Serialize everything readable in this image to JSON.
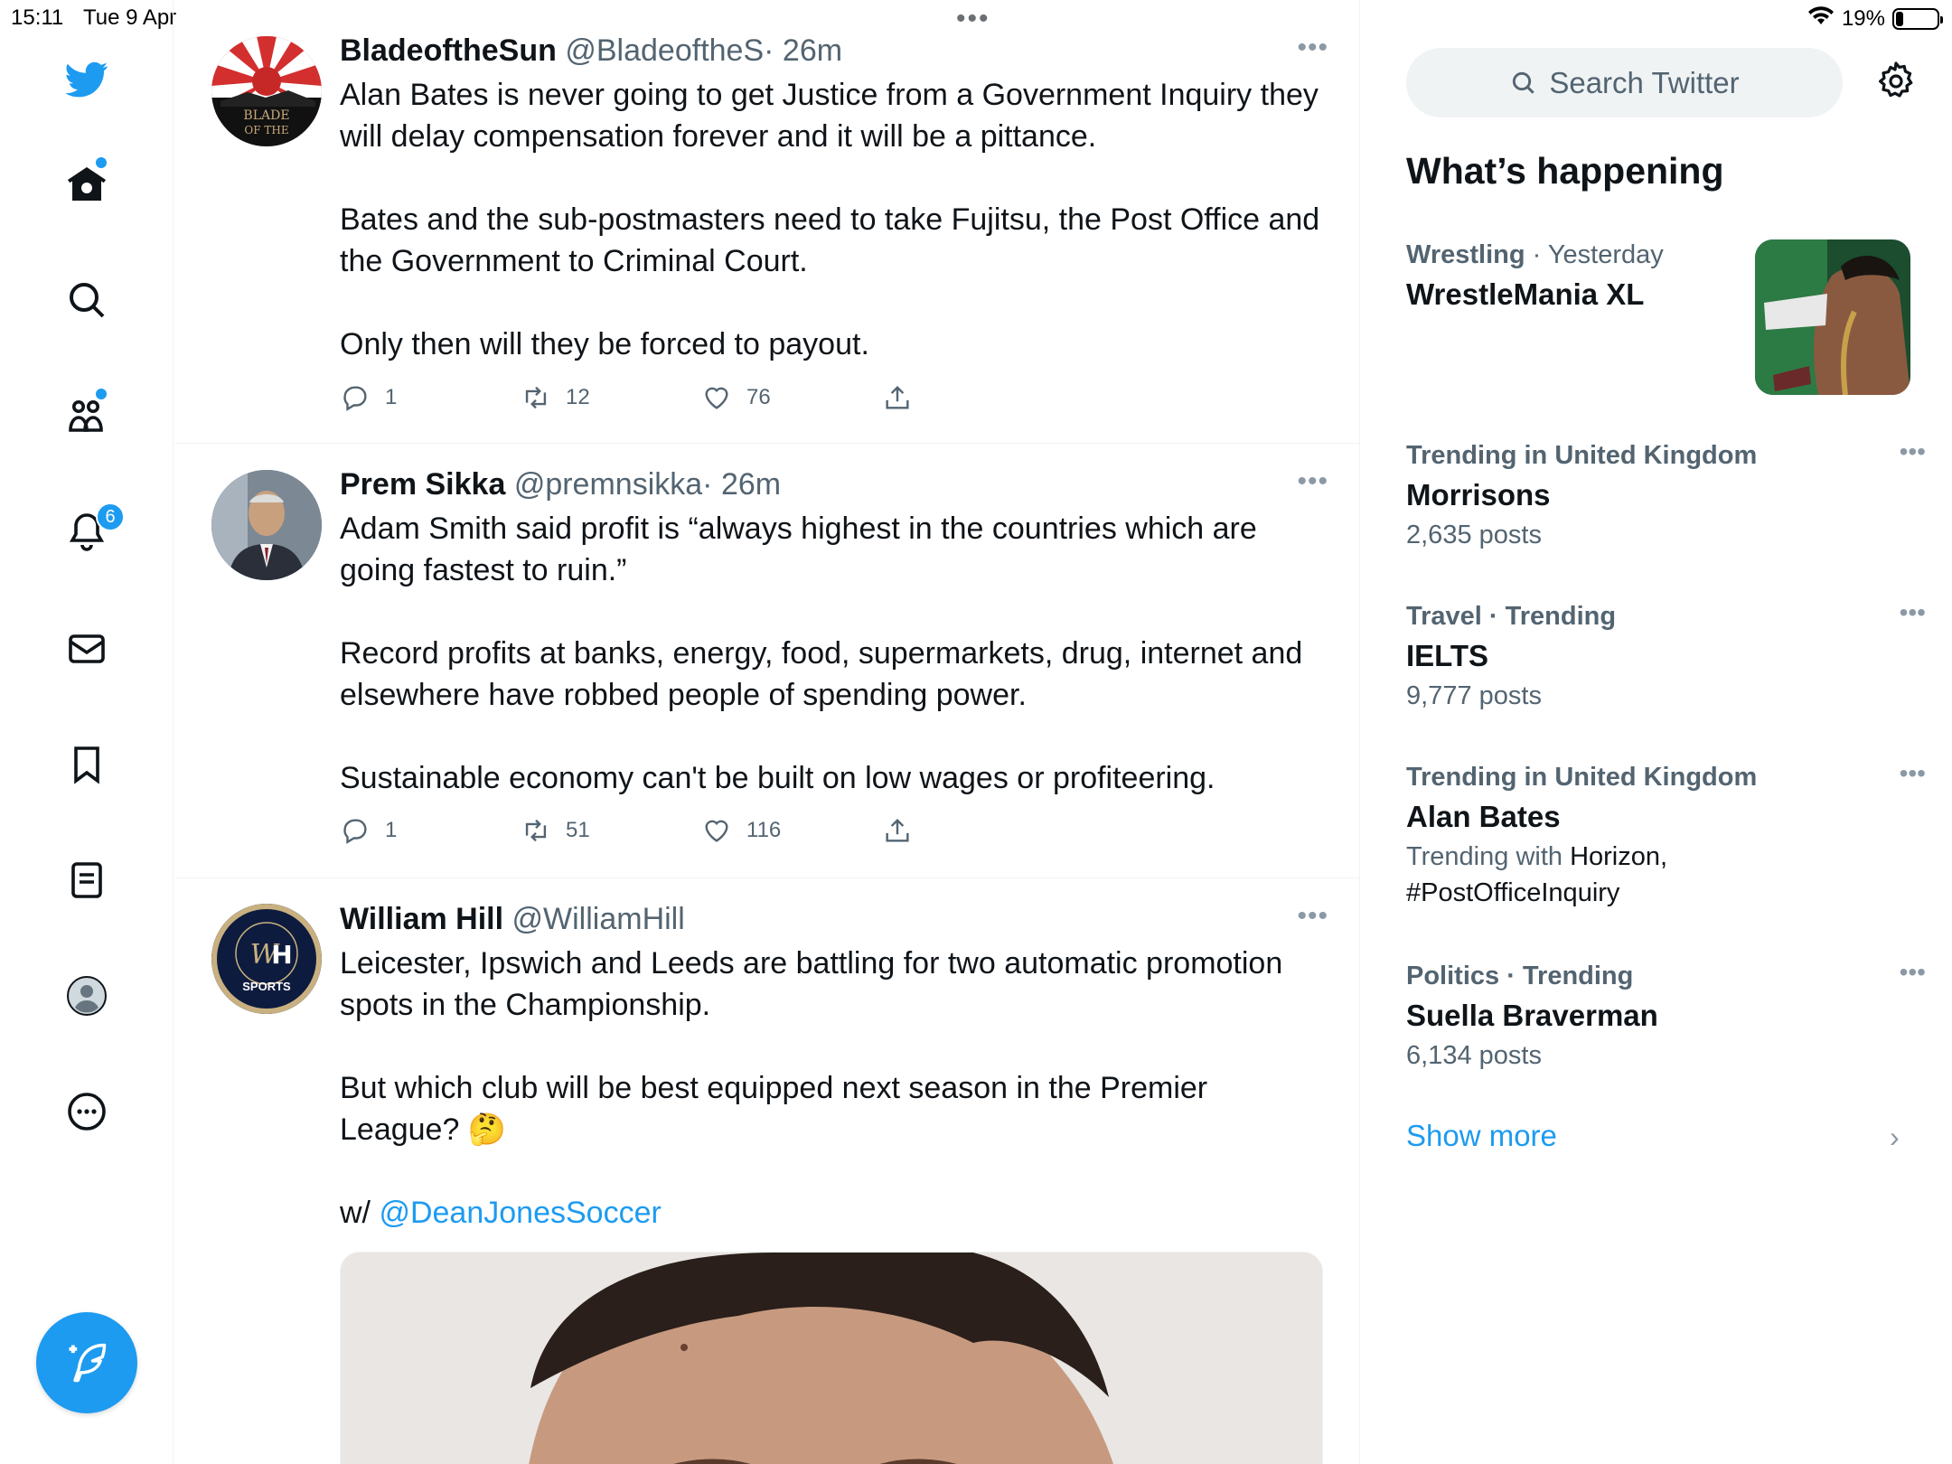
{
  "status_bar": {
    "time": "15:11",
    "date": "Tue 9 Apr",
    "battery_text": "19%",
    "battery_level": 0.19
  },
  "nav": {
    "notifications_count": "6"
  },
  "tweets": [
    {
      "name": "BladeoftheSun",
      "handle": "@BladeoftheS",
      "time": "· 26m",
      "text": "Alan Bates is never going to get Justice from a Government Inquiry they will delay compensation forever and it will be a pittance.\n\nBates and the sub-postmasters need to take Fujitsu, the Post Office and the Government to Criminal Court.\n\nOnly then will they be forced to payout.",
      "replies": "1",
      "retweets": "12",
      "likes": "76"
    },
    {
      "name": "Prem Sikka",
      "handle": "@premnsikka",
      "time": "· 26m",
      "text": "Adam Smith said profit is “always highest in the countries which are going fastest to ruin.”\n\nRecord profits at banks, energy, food, supermarkets, drug, internet and elsewhere have robbed people of spending power.\n\nSustainable economy can't be built on low wages or profiteering.",
      "replies": "1",
      "retweets": "51",
      "likes": "116"
    },
    {
      "name": "William Hill",
      "handle": "@WilliamHill",
      "text": "Leicester, Ipswich and Leeds are battling for two automatic promotion spots in the Championship.\n\nBut which club will be best equipped next season in the Premier League? 🤔\n\nw/ ",
      "mention": "@DeanJonesSoccer",
      "avatar_text": "SPORTS"
    }
  ],
  "sidebar": {
    "search_placeholder": "Search Twitter",
    "heading": "What’s happening",
    "trends": [
      {
        "category": "Wrestling",
        "when": " · Yesterday",
        "title": "WrestleMania XL"
      },
      {
        "category": "Trending in United Kingdom",
        "title": "Morrisons",
        "sub": "2,635 posts"
      },
      {
        "category": "Travel · Trending",
        "title": "IELTS",
        "sub": "9,777 posts"
      },
      {
        "category": "Trending in United Kingdom",
        "title": "Alan Bates",
        "sub_prefix": "Trending with ",
        "sub_dark": "Horizon,",
        "sub_line2": "#PostOfficeInquiry"
      },
      {
        "category": "Politics · Trending",
        "title": "Suella Braverman",
        "sub": "6,134 posts"
      }
    ],
    "show_more": "Show more"
  },
  "colors": {
    "accent": "#1d9bf0",
    "text": "#0f1419",
    "muted": "#536471",
    "border": "#eff3f4"
  }
}
